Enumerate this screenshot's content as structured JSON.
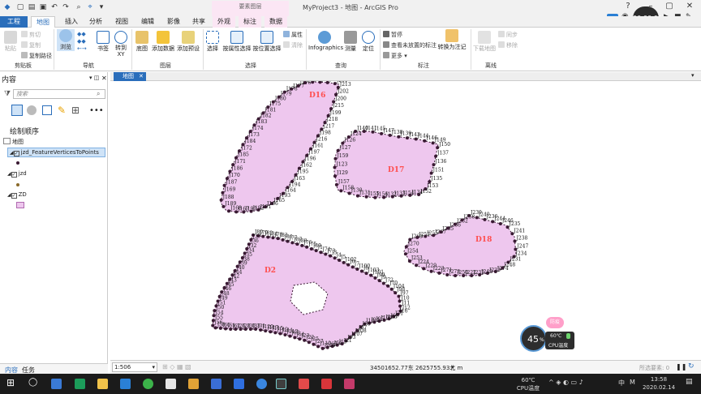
{
  "window": {
    "title": "MyProject3 - 地图 - ArcGIS Pro",
    "context_group": "要素图层",
    "help": "?",
    "recorder_time": "00:00:00"
  },
  "tabs": [
    {
      "label": "工程",
      "kind": "file"
    },
    {
      "label": "地图",
      "kind": "active"
    },
    {
      "label": "插入",
      "kind": "normal"
    },
    {
      "label": "分析",
      "kind": "normal"
    },
    {
      "label": "视图",
      "kind": "normal"
    },
    {
      "label": "编辑",
      "kind": "normal"
    },
    {
      "label": "影像",
      "kind": "normal"
    },
    {
      "label": "共享",
      "kind": "normal"
    },
    {
      "label": "外观",
      "kind": "ctx"
    },
    {
      "label": "标注",
      "kind": "ctx"
    },
    {
      "label": "数据",
      "kind": "ctx"
    }
  ],
  "ribbon": {
    "clipboard": {
      "paste": "粘贴",
      "cut": "剪切",
      "copy": "复制",
      "copy_path": "复制路径",
      "group": "剪贴板"
    },
    "navigate": {
      "explore": "浏览",
      "bookmarks": "书签",
      "goto_xy": "转到\nXY",
      "group": "导航"
    },
    "layer": {
      "basemap": "底图",
      "add_data": "添加数据",
      "add_preset": "添加预设",
      "group": "图层"
    },
    "selection": {
      "select": "选择",
      "by_attr": "按属性选择",
      "by_loc": "按位置选择",
      "attributes": "属性",
      "clear": "清除",
      "group": "选择"
    },
    "inquiry": {
      "infographics": "Infographics",
      "measure": "测量",
      "locate": "定位",
      "group": "查询"
    },
    "labeling": {
      "pause": "暂停",
      "view_unplaced": "查看未放置的标注",
      "more": "更多",
      "convert": "转换为注记",
      "group": "标注"
    },
    "offline": {
      "download": "下载地图",
      "sync": "同步",
      "remove": "移除",
      "group": "离线"
    }
  },
  "contents": {
    "title": "内容",
    "search_placeholder": "搜索",
    "drawing_order": "绘制顺序",
    "map_name": "地图",
    "layers": [
      {
        "name": "jzd_FeatureVerticesToPoints",
        "checked": true,
        "selected": true
      },
      {
        "name": "jzd",
        "checked": true,
        "selected": false
      },
      {
        "name": "ZD",
        "checked": true,
        "selected": false
      }
    ],
    "footer_tabs": [
      "内容",
      "任务"
    ]
  },
  "map_view": {
    "tab_label": "地图"
  },
  "status": {
    "scale": "1:506",
    "coords": "34501652.77东 2625755.93北 m",
    "selected_features": "所选要素: 0"
  },
  "cpu_widget": {
    "percent": "45",
    "unit": "%",
    "temp": "60℃",
    "label": "CPU温度",
    "badge": "防疫"
  },
  "taskbar": {
    "cpu_temp": "60℃",
    "cpu_label": "CPU温度",
    "time": "13:58",
    "date": "2020.02.14",
    "ime": "中"
  },
  "colors": {
    "accent": "#2a6ebb",
    "polygon_fill": "#eec7ee",
    "polygon_label": "#ff4d4d",
    "vertex": "#3a1a33"
  },
  "map_labels": {
    "polygons": [
      "D16",
      "D17",
      "D18",
      "D2"
    ],
    "vertices_top": [
      "J203",
      "J204",
      "J211",
      "J212",
      "J201",
      "J213",
      "J202",
      "J200",
      "J215",
      "J199",
      "J218",
      "J217",
      "J198",
      "J216",
      "J161",
      "J197",
      "J196",
      "J162",
      "J195",
      "J163",
      "J194",
      "J164",
      "J193",
      "J165",
      "J166",
      "J191",
      "J192",
      "J190",
      "J167",
      "J168",
      "J189",
      "J188",
      "J169",
      "J187",
      "J170",
      "J186",
      "J171",
      "J185",
      "J172",
      "J184",
      "J173",
      "J174",
      "J183",
      "J182",
      "J181",
      "J175",
      "J180",
      "J179",
      "J178",
      "J177",
      "J176"
    ],
    "vertices_mid": [
      "J140",
      "J141",
      "J145",
      "J147",
      "J138",
      "J139",
      "J143",
      "J144",
      "J146",
      "J149",
      "J150",
      "J137",
      "J136",
      "J151",
      "J135",
      "J153",
      "J152",
      "J134",
      "J154",
      "J133",
      "J132",
      "J156",
      "J155",
      "J131",
      "J130",
      "J158",
      "J157",
      "J129",
      "J123",
      "J159",
      "J127",
      "J126",
      "J124"
    ],
    "vertices_right": [
      "J239",
      "J240",
      "J236",
      "J244",
      "J246",
      "J235",
      "J241",
      "J238",
      "J247",
      "J234",
      "J231",
      "J248",
      "J274",
      "J233",
      "J249",
      "J232",
      "J222",
      "J250",
      "J273",
      "J271",
      "J223",
      "J229",
      "J224",
      "J253",
      "J254",
      "J270",
      "J269",
      "J257",
      "J255",
      "J267",
      "J265",
      "J266",
      "J262",
      "J258"
    ],
    "vertices_bottom": [
      "J80",
      "J79",
      "J82",
      "J84",
      "J78",
      "J83",
      "J86",
      "J77",
      "J87",
      "J88",
      "J76",
      "J75",
      "J89",
      "J1",
      "J74",
      "J73",
      "J3",
      "J4",
      "J5",
      "J102",
      "J6",
      "J7",
      "J100",
      "J8",
      "J103",
      "J101",
      "J99",
      "J9",
      "J72",
      "J70",
      "J104",
      "J98",
      "J97",
      "J10",
      "J11",
      "J12",
      "J16",
      "J71",
      "J69",
      "J106",
      "J105",
      "J95",
      "J94",
      "J18",
      "J68",
      "J67",
      "J108",
      "J107",
      "J93",
      "J21",
      "J19",
      "J66",
      "J65",
      "J109",
      "J110",
      "J27",
      "J25",
      "J22",
      "J23",
      "J64",
      "J63",
      "J113",
      "J111",
      "J112",
      "J115",
      "J117",
      "J120",
      "J31",
      "J33",
      "J30",
      "J28",
      "J26",
      "J62",
      "J61",
      "J60",
      "J58",
      "J56",
      "J55",
      "J54",
      "J50",
      "J51",
      "J49",
      "J48",
      "J46",
      "J45",
      "J43",
      "J42",
      "J44",
      "J40",
      "J39",
      "J38",
      "J35",
      "J34",
      "J32",
      "J36",
      "J37"
    ]
  }
}
